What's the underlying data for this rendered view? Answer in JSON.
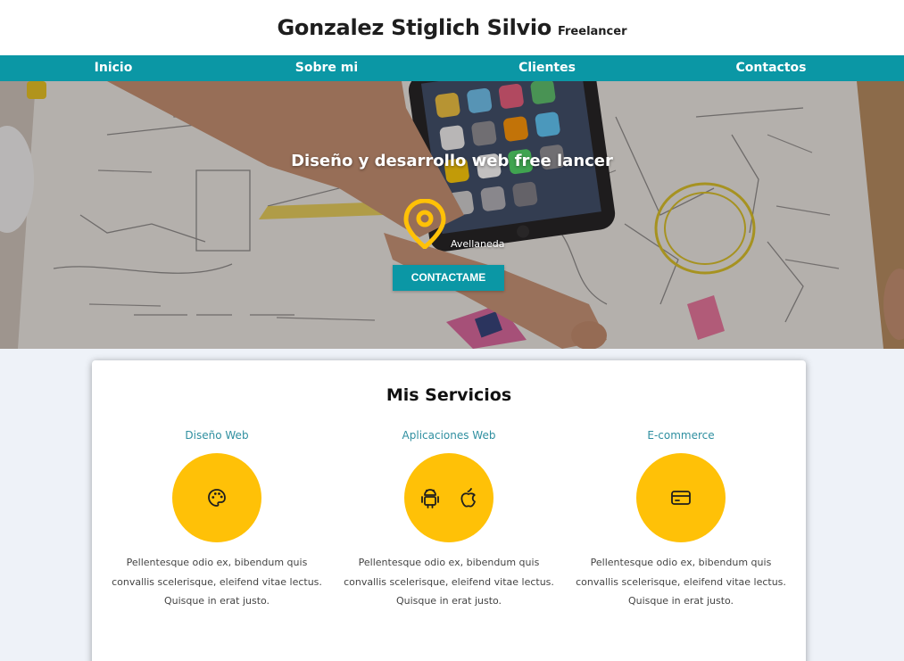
{
  "header": {
    "name": "Gonzalez Stiglich Silvio",
    "role": "Freelancer"
  },
  "nav": {
    "items": [
      "Inicio",
      "Sobre mi",
      "Clientes",
      "Contactos"
    ]
  },
  "hero": {
    "title": "Diseño y desarrollo web free lancer",
    "location": "Avellaneda",
    "cta_label": "CONTACTAME",
    "pin_icon": "map-pin-icon"
  },
  "services": {
    "heading": "Mis Servicios",
    "items": [
      {
        "title": "Diseño Web",
        "icons": [
          "palette-icon"
        ],
        "description": "Pellentesque odio ex, bibendum quis convallis scelerisque, eleifend vitae lectus. Quisque in erat justo."
      },
      {
        "title": "Aplicaciones Web",
        "icons": [
          "android-icon",
          "apple-icon"
        ],
        "description": "Pellentesque odio ex, bibendum quis convallis scelerisque, eleifend vitae lectus. Quisque in erat justo."
      },
      {
        "title": "E-commerce",
        "icons": [
          "credit-card-icon"
        ],
        "description": "Pellentesque odio ex, bibendum quis convallis scelerisque, eleifend vitae lectus. Quisque in erat justo."
      }
    ]
  },
  "colors": {
    "teal": "#0b97a5",
    "yellow": "#ffc107",
    "service_title": "#2f8fa0"
  }
}
